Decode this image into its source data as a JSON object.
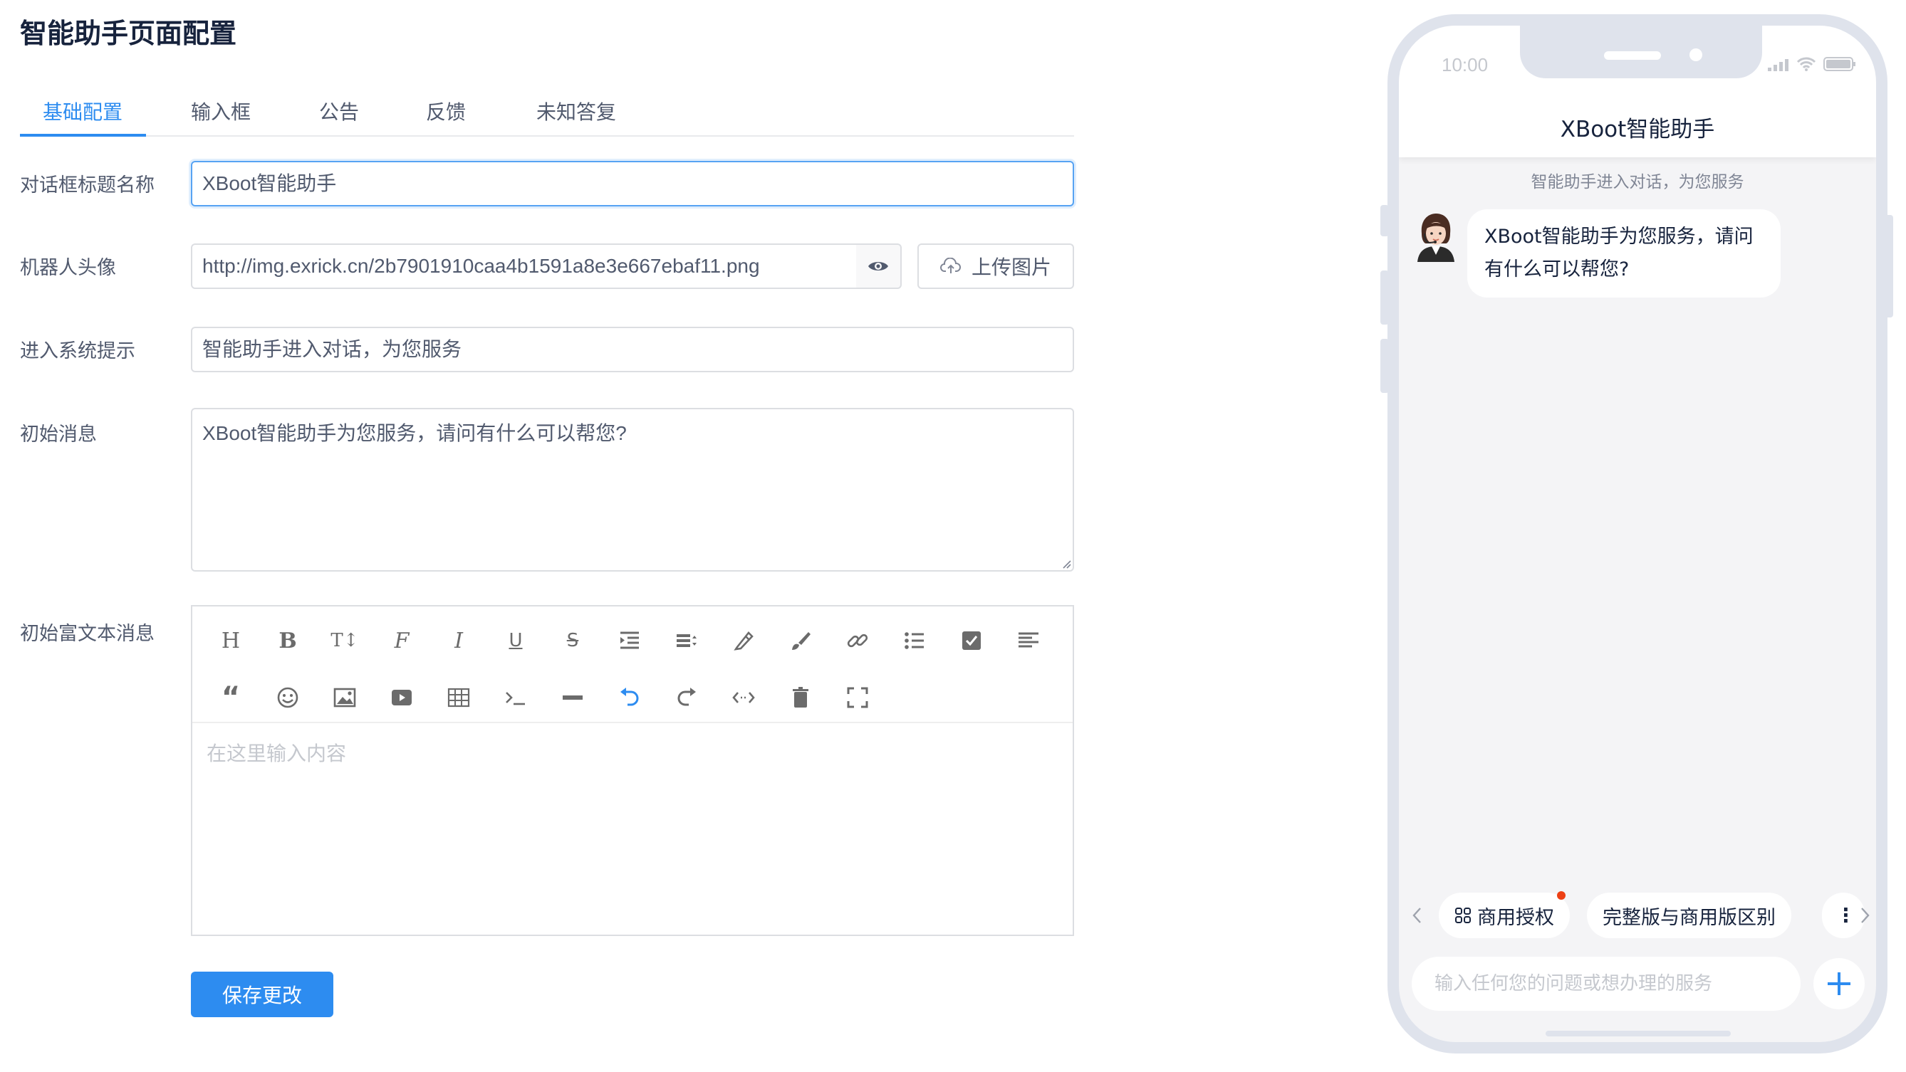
{
  "page": {
    "title": "智能助手页面配置"
  },
  "tabs": [
    {
      "label": "基础配置",
      "active": true
    },
    {
      "label": "输入框",
      "active": false
    },
    {
      "label": "公告",
      "active": false
    },
    {
      "label": "反馈",
      "active": false
    },
    {
      "label": "未知答复",
      "active": false
    }
  ],
  "form": {
    "dialog_title": {
      "label": "对话框标题名称",
      "value": "XBoot智能助手"
    },
    "robot_avatar": {
      "label": "机器人头像",
      "value": "http://img.exrick.cn/2b7901910caa4b1591a8e3e667ebaf11.png",
      "upload_label": "上传图片"
    },
    "enter_tip": {
      "label": "进入系统提示",
      "value": "智能助手进入对话，为您服务"
    },
    "initial_message": {
      "label": "初始消息",
      "value": "XBoot智能助手为您服务，请问有什么可以帮您?"
    },
    "rich_message": {
      "label": "初始富文本消息",
      "placeholder": "在这里输入内容"
    },
    "save_label": "保存更改"
  },
  "editor_tools": {
    "row1": [
      "heading",
      "bold",
      "font-size",
      "font-family",
      "italic",
      "underline",
      "strikethrough",
      "indent",
      "line-height",
      "fore-color",
      "back-color",
      "link",
      "list",
      "todo",
      "justify"
    ],
    "row2": [
      "quote",
      "emoticon",
      "image",
      "video",
      "table",
      "code",
      "divider",
      "undo",
      "redo",
      "html",
      "delete",
      "fullscreen"
    ]
  },
  "preview": {
    "status_time": "10:00",
    "chat_title": "XBoot智能助手",
    "system_tip": "智能助手进入对话，为您服务",
    "bot_message": "XBoot智能助手为您服务，请问有什么可以帮您?",
    "quick_chips": [
      "商用授权",
      "完整版与商用版区别"
    ],
    "input_placeholder": "输入任何您的问题或想办理的服务"
  },
  "colors": {
    "accent": "#2d8cf0",
    "badge": "#ed4014",
    "phone_frame": "#dfe3ec"
  }
}
